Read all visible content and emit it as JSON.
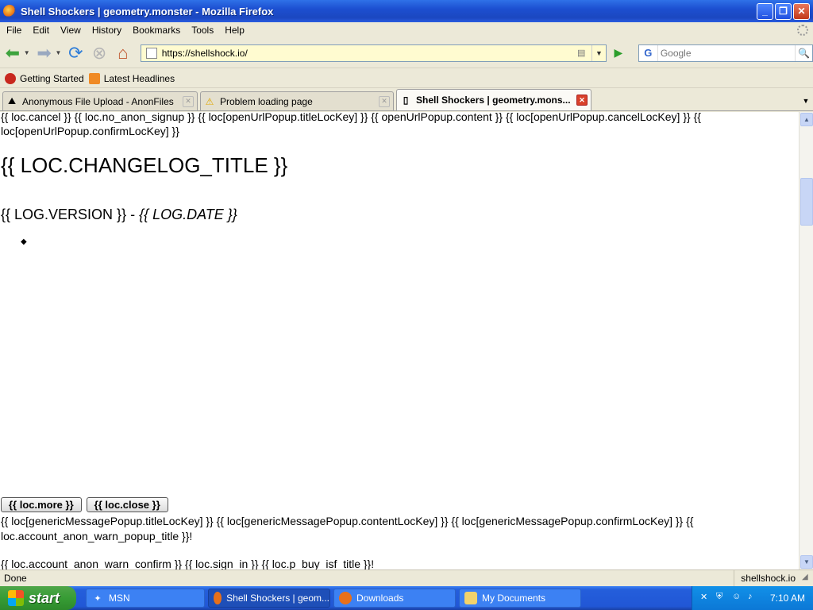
{
  "window": {
    "title": "Shell Shockers | geometry.monster - Mozilla Firefox"
  },
  "menu": [
    "File",
    "Edit",
    "View",
    "History",
    "Bookmarks",
    "Tools",
    "Help"
  ],
  "nav": {
    "url": "https://shellshock.io/",
    "search_placeholder": "Google"
  },
  "bookmarks": [
    "Getting Started",
    "Latest Headlines"
  ],
  "tabs": [
    {
      "label": "Anonymous File Upload - AnonFiles",
      "active": false
    },
    {
      "label": "Problem loading page",
      "active": false
    },
    {
      "label": "Shell Shockers | geometry.mons...",
      "active": true
    }
  ],
  "page": {
    "line1": "{{ loc.cancel }} {{ loc.no_anon_signup }} {{ loc[openUrlPopup.titleLocKey] }} {{ openUrlPopup.content }} {{ loc[openUrlPopup.cancelLocKey] }} {{",
    "line2": "loc[openUrlPopup.confirmLocKey] }}",
    "changelog_title": "{{ LOC.CHANGELOG_TITLE }}",
    "log_version": "{{ LOG.VERSION }} - ",
    "log_date": "{{ LOG.DATE }}",
    "bullet": "◆",
    "btn_more": "{{ loc.more }}",
    "btn_close": "{{ loc.close }}",
    "line3": "{{ loc[genericMessagePopup.titleLocKey] }} {{ loc[genericMessagePopup.contentLocKey] }} {{ loc[genericMessagePopup.confirmLocKey] }} {{",
    "line4": "loc.account_anon_warn_popup_title }}!",
    "line5": "{{ loc.account_anon_warn_confirm }} {{ loc.sign_in }} {{ loc.p_buy_isf_title }}!"
  },
  "status": {
    "text": "Done",
    "host": "shellshock.io"
  },
  "taskbar": {
    "start": "start",
    "items": [
      {
        "label": "MSN",
        "active": false
      },
      {
        "label": "Shell Shockers | geom...",
        "active": true
      },
      {
        "label": "Downloads",
        "active": false
      },
      {
        "label": "My Documents",
        "active": false
      }
    ],
    "clock": "7:10 AM"
  }
}
